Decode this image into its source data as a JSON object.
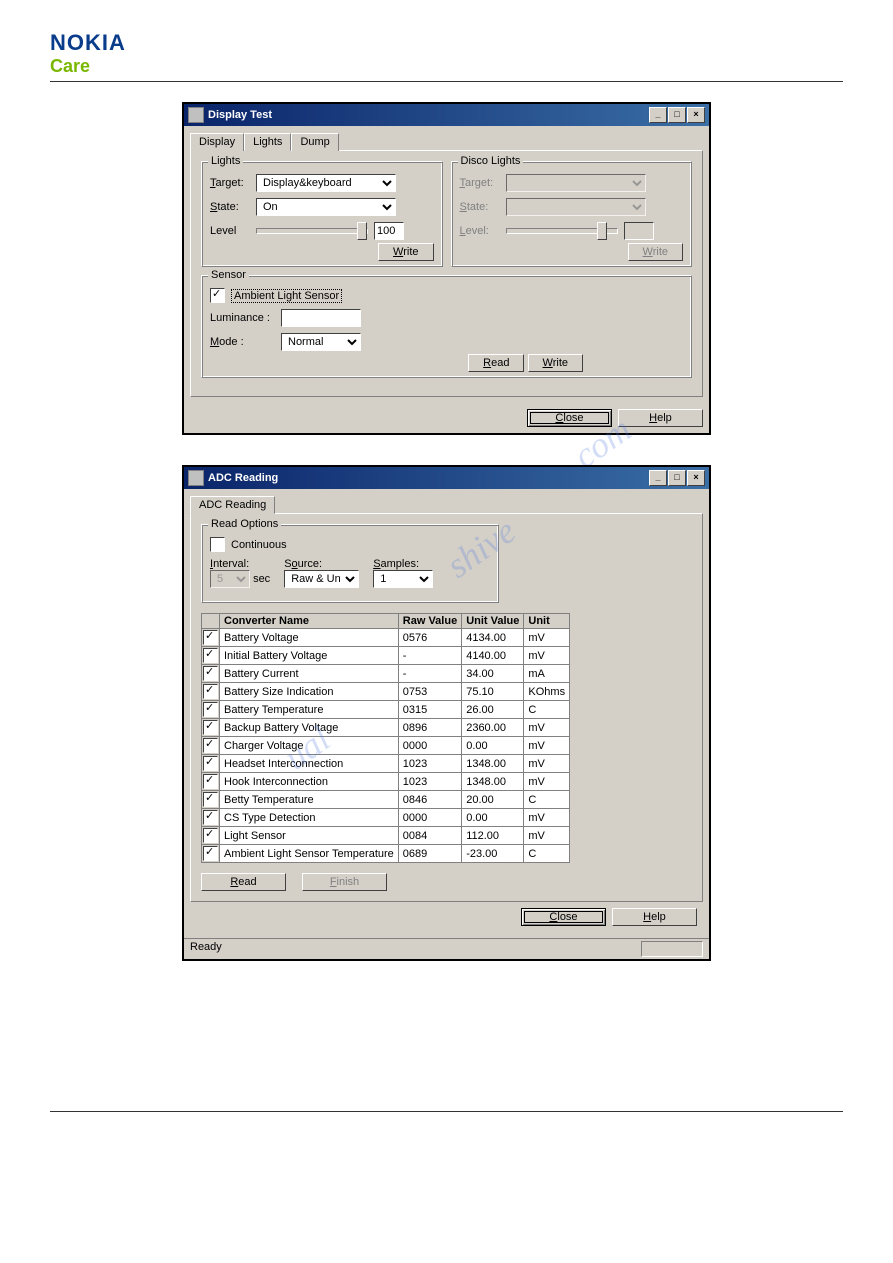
{
  "brand": {
    "name": "NOKIA",
    "sub": "Care"
  },
  "display_test": {
    "title": "Display Test",
    "tabs": {
      "display": "Display",
      "lights": "Lights",
      "dump": "Dump"
    },
    "lights_group": {
      "title": "Lights",
      "target_label": "Target:",
      "target_value": "Display&keyboard",
      "state_label": "State:",
      "state_value": "On",
      "level_label": "Level",
      "level_value": "100",
      "write_label": "Write"
    },
    "disco_group": {
      "title": "Disco Lights",
      "target_label": "Target:",
      "state_label": "State:",
      "level_label": "Level:",
      "write_label": "Write"
    },
    "sensor_group": {
      "title": "Sensor",
      "ambient_label": "Ambient Light Sensor",
      "luminance_label": "Luminance :",
      "mode_label": "Mode :",
      "mode_value": "Normal",
      "read_label": "Read",
      "write_label": "Write"
    },
    "footer": {
      "close": "Close",
      "help": "Help"
    }
  },
  "adc": {
    "title": "ADC Reading",
    "tab": "ADC Reading",
    "read_options": {
      "title": "Read Options",
      "continuous": "Continuous",
      "interval_label": "Interval:",
      "interval_value": "5",
      "interval_unit": "sec",
      "source_label": "Source:",
      "source_value": "Raw & Unit",
      "samples_label": "Samples:",
      "samples_value": "1"
    },
    "headers": {
      "name": "Converter Name",
      "raw": "Raw Value",
      "unit_value": "Unit Value",
      "unit": "Unit"
    },
    "rows": [
      {
        "name": "Battery Voltage",
        "raw": "0576",
        "uv": "4134.00",
        "u": "mV"
      },
      {
        "name": "Initial Battery Voltage",
        "raw": "-",
        "uv": "4140.00",
        "u": "mV"
      },
      {
        "name": "Battery Current",
        "raw": "-",
        "uv": "34.00",
        "u": "mA"
      },
      {
        "name": "Battery Size Indication",
        "raw": "0753",
        "uv": "75.10",
        "u": "KOhms"
      },
      {
        "name": "Battery Temperature",
        "raw": "0315",
        "uv": "26.00",
        "u": "C"
      },
      {
        "name": "Backup Battery Voltage",
        "raw": "0896",
        "uv": "2360.00",
        "u": "mV"
      },
      {
        "name": "Charger Voltage",
        "raw": "0000",
        "uv": "0.00",
        "u": "mV"
      },
      {
        "name": "Headset Interconnection",
        "raw": "1023",
        "uv": "1348.00",
        "u": "mV"
      },
      {
        "name": "Hook Interconnection",
        "raw": "1023",
        "uv": "1348.00",
        "u": "mV"
      },
      {
        "name": "Betty Temperature",
        "raw": "0846",
        "uv": "20.00",
        "u": "C"
      },
      {
        "name": "CS Type Detection",
        "raw": "0000",
        "uv": "0.00",
        "u": "mV"
      },
      {
        "name": "Light Sensor",
        "raw": "0084",
        "uv": "112.00",
        "u": "mV"
      },
      {
        "name": "Ambient Light Sensor Temperature",
        "raw": "0689",
        "uv": "-23.00",
        "u": "C"
      }
    ],
    "buttons": {
      "read": "Read",
      "finish": "Finish",
      "close": "Close",
      "help": "Help"
    },
    "status": "Ready"
  }
}
